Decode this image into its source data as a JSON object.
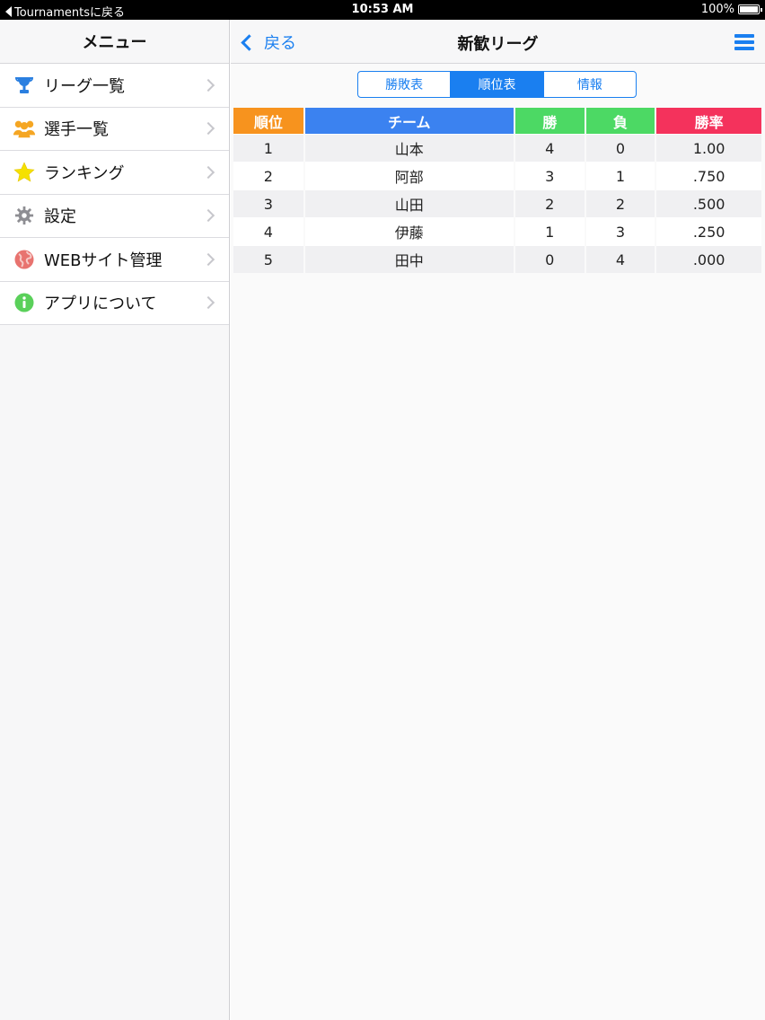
{
  "status_bar": {
    "back_label": "Tournamentsに戻る",
    "time": "10:53 AM",
    "battery": "100%",
    "battery_level": 1.0
  },
  "sidebar": {
    "title": "メニュー",
    "items": [
      {
        "label": "リーグ一覧",
        "icon": "trophy-icon",
        "color": "#2a7fe0"
      },
      {
        "label": "選手一覧",
        "icon": "players-icon",
        "color": "#f5a623"
      },
      {
        "label": "ランキング",
        "icon": "star-icon",
        "color": "#f5e100"
      },
      {
        "label": "設定",
        "icon": "gear-icon",
        "color": "#8e8e93"
      },
      {
        "label": "WEBサイト管理",
        "icon": "globe-icon",
        "color": "#e8736f"
      },
      {
        "label": "アプリについて",
        "icon": "info-icon",
        "color": "#5ad05a"
      }
    ]
  },
  "navbar": {
    "back_label": "戻る",
    "title": "新歓リーグ"
  },
  "segments": [
    {
      "label": "勝敗表",
      "active": false
    },
    {
      "label": "順位表",
      "active": true
    },
    {
      "label": "情報",
      "active": false
    }
  ],
  "standings": {
    "headers": [
      {
        "label": "順位",
        "color": "#f7931e"
      },
      {
        "label": "チーム",
        "color": "#3b82f0"
      },
      {
        "label": "勝",
        "color": "#4cd964"
      },
      {
        "label": "負",
        "color": "#4cd964"
      },
      {
        "label": "勝率",
        "color": "#f4325c"
      }
    ],
    "rows": [
      [
        "1",
        "山本",
        "4",
        "0",
        "1.00"
      ],
      [
        "2",
        "阿部",
        "3",
        "1",
        ".750"
      ],
      [
        "3",
        "山田",
        "2",
        "2",
        ".500"
      ],
      [
        "4",
        "伊藤",
        "1",
        "3",
        ".250"
      ],
      [
        "5",
        "田中",
        "0",
        "4",
        ".000"
      ]
    ]
  },
  "colors": {
    "accent": "#1a7ff0"
  }
}
